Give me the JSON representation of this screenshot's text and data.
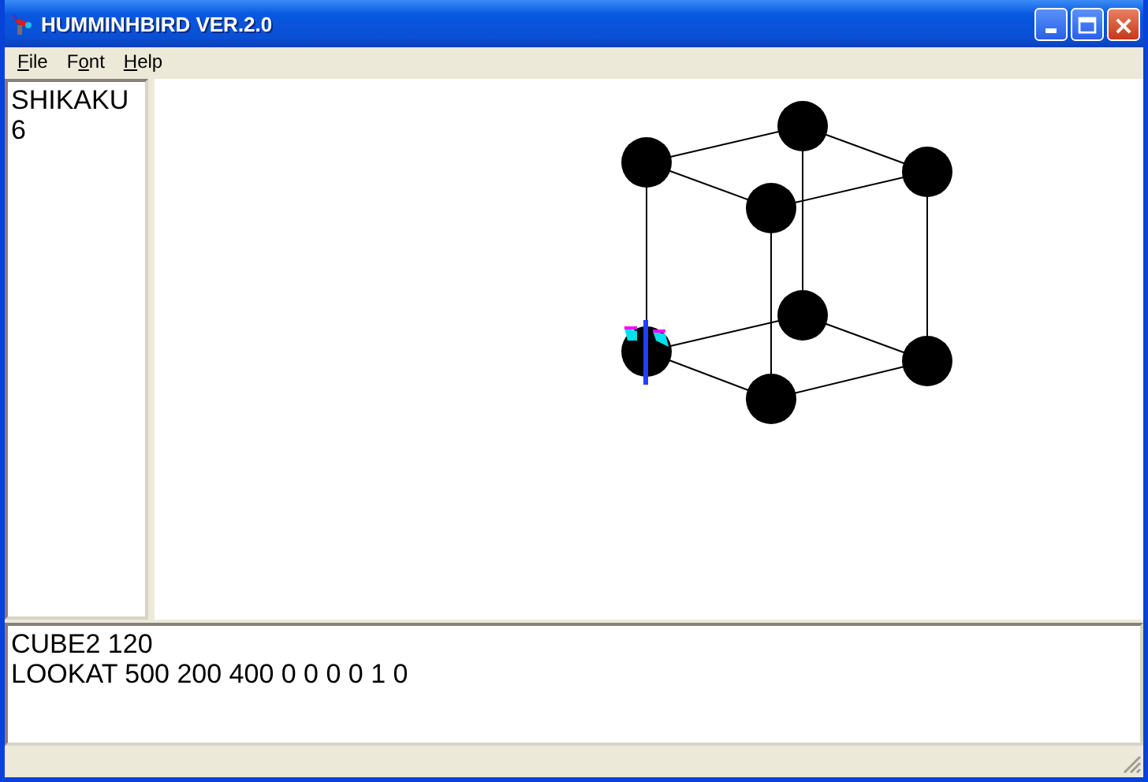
{
  "window": {
    "title": "HUMMINHBIRD VER.2.0"
  },
  "menu": [
    {
      "key": "F",
      "rest": "ile"
    },
    {
      "lead": "F",
      "key": "o",
      "rest": "nt"
    },
    {
      "key": "H",
      "rest": "elp"
    }
  ],
  "side_panel": {
    "lines": [
      "SHIKAKU",
      "6"
    ]
  },
  "editor": {
    "lines": [
      "CUBE2 120",
      "LOOKAT 500 200 400 0 0 0 0 1 0"
    ]
  }
}
